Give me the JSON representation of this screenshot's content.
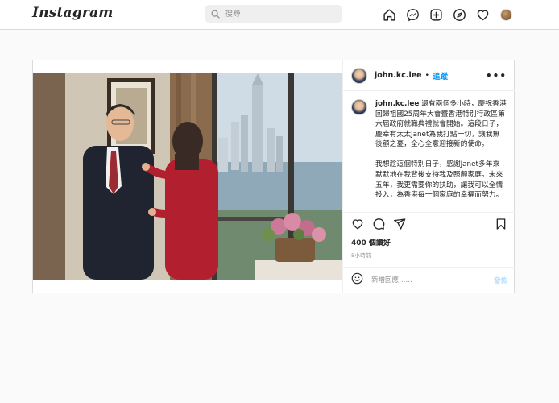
{
  "app": {
    "logo_text": "Instagram"
  },
  "search": {
    "placeholder": "搜尋"
  },
  "nav": {
    "icons": [
      "home-icon",
      "messenger-icon",
      "new-post-icon",
      "explore-icon",
      "heart-icon",
      "profile-avatar"
    ]
  },
  "post": {
    "username": "john.kc.lee",
    "separator": "•",
    "follow_label": "追蹤",
    "more_label": "•••",
    "caption_user": "john.kc.lee",
    "caption_p1": "還有兩個多小時，慶祝香港回歸祖國25周年大會暨香港特別行政區第六屆政府就職典禮就會開始。這段日子，慶幸有太太Janet為我打點一切，讓我無後顧之憂，全心全意迎接新的使命。",
    "caption_p2": "我想趁這個特別日子，感謝Janet多年來默默地在我背後支持我及照顧家庭。未來五年，我更需要你的扶助，讓我可以全情投入，為香港每一個家庭的幸福而努力。",
    "likes": "400 個讚好",
    "time": "5小時前",
    "comment_placeholder": "新增回應……",
    "post_button": "發佈"
  },
  "colors": {
    "link": "#0095f6",
    "post_disabled": "#b3dbff",
    "border": "#dbdbdb"
  }
}
